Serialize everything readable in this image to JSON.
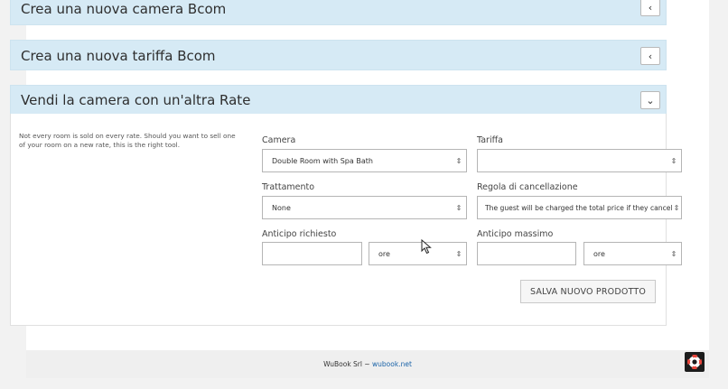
{
  "panels": [
    {
      "title": "Crea una nuova camera Bcom",
      "toggle": "‹"
    },
    {
      "title": "Crea una nuova tariffa Bcom",
      "toggle": "‹"
    },
    {
      "title": "Vendi la camera con un'altra Rate",
      "toggle": "⌄"
    }
  ],
  "form": {
    "description": "Not every room is sold on every rate. Should you want to sell one of your room on a new rate, this is the right tool.",
    "camera": {
      "label": "Camera",
      "value": "Double Room with Spa Bath"
    },
    "tariffa": {
      "label": "Tariffa",
      "value": ""
    },
    "trattamento": {
      "label": "Trattamento",
      "value": "None"
    },
    "regola": {
      "label": "Regola di cancellazione",
      "value": "The guest will be charged the total price if they cancel"
    },
    "anticipo_richiesto": {
      "label": "Anticipo richiesto",
      "value": "",
      "unit": "ore"
    },
    "anticipo_massimo": {
      "label": "Anticipo massimo",
      "value": "",
      "unit": "ore"
    },
    "save_label": "SALVA NUOVO PRODOTTO",
    "select_arrows": "⇕"
  },
  "footer": {
    "company": "WuBook Srl ~ ",
    "link": "wubook.net"
  },
  "colors": {
    "panel_bg": "#d6eaf5",
    "link": "#1a63a8",
    "help_icon_ring": "#e8463c"
  },
  "icons": {
    "help": "lifebuoy-icon",
    "cursor": "mouse-pointer-icon"
  }
}
